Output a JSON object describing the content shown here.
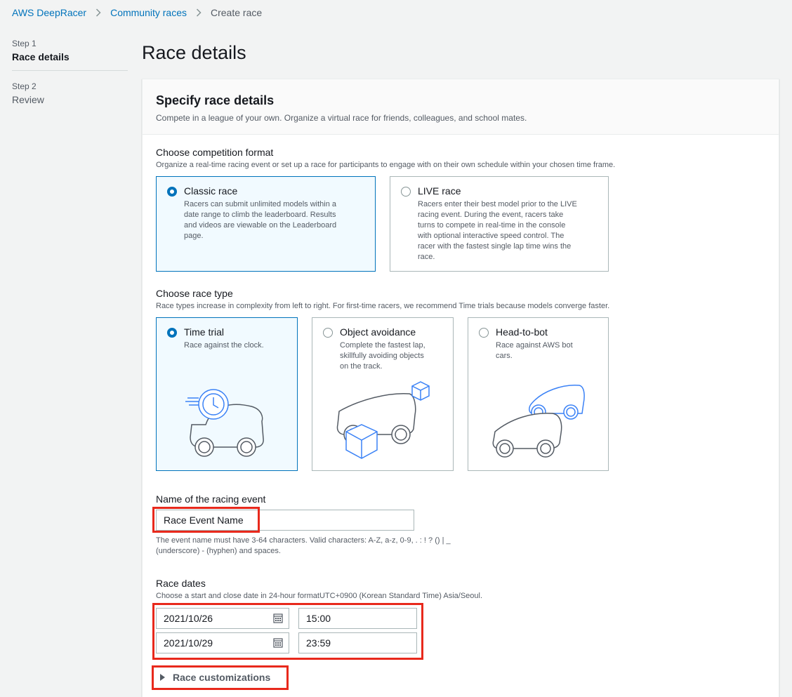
{
  "breadcrumb": {
    "items": [
      "AWS DeepRacer",
      "Community races"
    ],
    "current": "Create race"
  },
  "steps": [
    {
      "number": "Step 1",
      "label": "Race details"
    },
    {
      "number": "Step 2",
      "label": "Review"
    }
  ],
  "page_title": "Race details",
  "container": {
    "title": "Specify race details",
    "description": "Compete in a league of your own. Organize a virtual race for friends, colleagues, and school mates."
  },
  "competition_format": {
    "label": "Choose competition format",
    "description": "Organize a real-time racing event or set up a race for participants to engage with on their own schedule within your chosen time frame.",
    "options": [
      {
        "title": "Classic race",
        "desc_lines": [
          "Racers can submit unlimited models within a",
          "date range to climb the leaderboard. Results",
          "and videos are viewable on the Leaderboard",
          "page."
        ],
        "selected": true
      },
      {
        "title": "LIVE race",
        "desc_lines": [
          "Racers enter their best model prior to the LIVE",
          "racing event. During the event, racers take",
          "turns to compete in real-time in the console",
          "with optional interactive speed control. The",
          "racer with the fastest single lap time wins the",
          "race."
        ],
        "selected": false
      }
    ]
  },
  "race_type": {
    "label": "Choose race type",
    "description": "Race types increase in complexity from left to right. For first-time racers, we recommend Time trials because models converge faster.",
    "options": [
      {
        "title": "Time trial",
        "desc_lines": [
          "Race against the clock."
        ],
        "selected": true,
        "illustration": "clock-car-icon"
      },
      {
        "title": "Object avoidance",
        "desc_lines": [
          "Complete the fastest lap,",
          "skillfully avoiding objects",
          "on the track."
        ],
        "selected": false,
        "illustration": "box-car-icon"
      },
      {
        "title": "Head-to-bot",
        "desc_lines": [
          "Race against AWS bot",
          "cars."
        ],
        "selected": false,
        "illustration": "two-cars-icon"
      }
    ]
  },
  "event_name": {
    "label": "Name of the racing event",
    "value": "Race Event Name",
    "hint_lines": [
      "The event name must have 3-64 characters. Valid characters: A-Z, a-z, 0-9, . : ! ? () | _",
      "(underscore) - (hyphen) and spaces."
    ]
  },
  "race_dates": {
    "label": "Race dates",
    "description": "Choose a start and close date in 24-hour formatUTC+0900 (Korean Standard Time) Asia/Seoul.",
    "start_date": "2021/10/26",
    "start_time": "15:00",
    "end_date": "2021/10/29",
    "end_time": "23:59"
  },
  "customizations": {
    "label": "Race customizations"
  },
  "colors": {
    "accent": "#0073bb",
    "highlight": "#e8291c",
    "illustration_blue": "#3b82f6",
    "illustration_gray": "#545b64"
  }
}
